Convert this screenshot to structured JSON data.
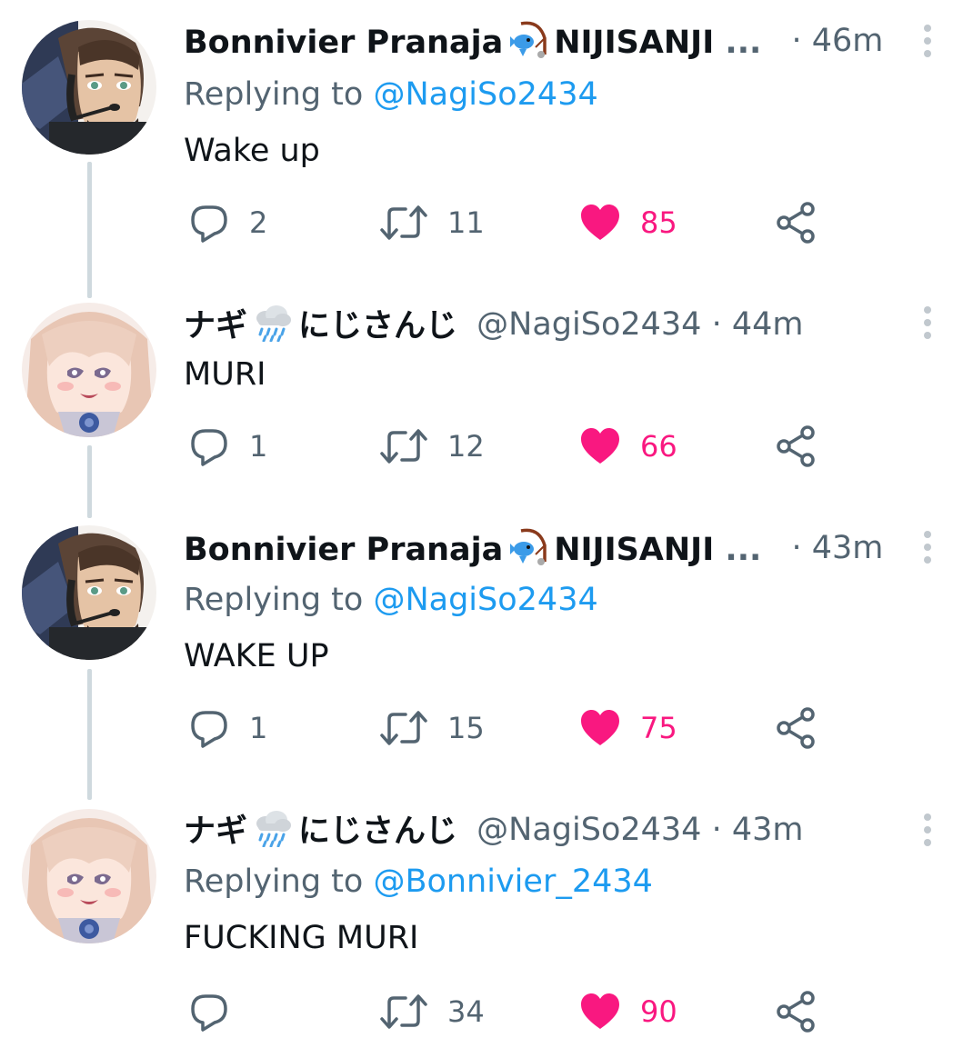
{
  "tweets": [
    {
      "display_name": "Bonnivier Pranaja",
      "affiliation": "NIJISANJI",
      "truncation": "...",
      "handle": "",
      "separator": "·",
      "time": "46m",
      "replying_prefix": "Replying to ",
      "replying_to": "@NagiSo2434",
      "text": "Wake up",
      "replies": "2",
      "retweets": "11",
      "likes": "85",
      "emoji": "fishing-emoji",
      "avatar": "bearded-man-with-headset-avatar"
    },
    {
      "display_name": "ナギ",
      "affiliation": "にじさんじ",
      "truncation": "",
      "handle": "@NagiSo2434",
      "separator": "·",
      "time": "44m",
      "replying_prefix": "",
      "replying_to": "",
      "text": "MURI",
      "replies": "1",
      "retweets": "12",
      "likes": "66",
      "emoji": "rain-cloud-emoji",
      "avatar": "blonde-anime-girl-avatar"
    },
    {
      "display_name": "Bonnivier Pranaja",
      "affiliation": "NIJISANJI",
      "truncation": "...",
      "handle": "",
      "separator": "·",
      "time": "43m",
      "replying_prefix": "Replying to ",
      "replying_to": "@NagiSo2434",
      "text": "WAKE UP",
      "replies": "1",
      "retweets": "15",
      "likes": "75",
      "emoji": "fishing-emoji",
      "avatar": "bearded-man-with-headset-avatar"
    },
    {
      "display_name": "ナギ",
      "affiliation": "にじさんじ",
      "truncation": "",
      "handle": "@NagiSo2434",
      "separator": "·",
      "time": "43m",
      "replying_prefix": "Replying to ",
      "replying_to": "@Bonnivier_2434",
      "text": "FUCKING MURI",
      "replies": "",
      "retweets": "34",
      "likes": "90",
      "emoji": "rain-cloud-emoji",
      "avatar": "blonde-anime-girl-avatar"
    }
  ],
  "colors": {
    "text_primary": "#0f1419",
    "text_secondary": "#536471",
    "link": "#1d9bf0",
    "like": "#f91880",
    "thread_line": "#cfd9de"
  }
}
